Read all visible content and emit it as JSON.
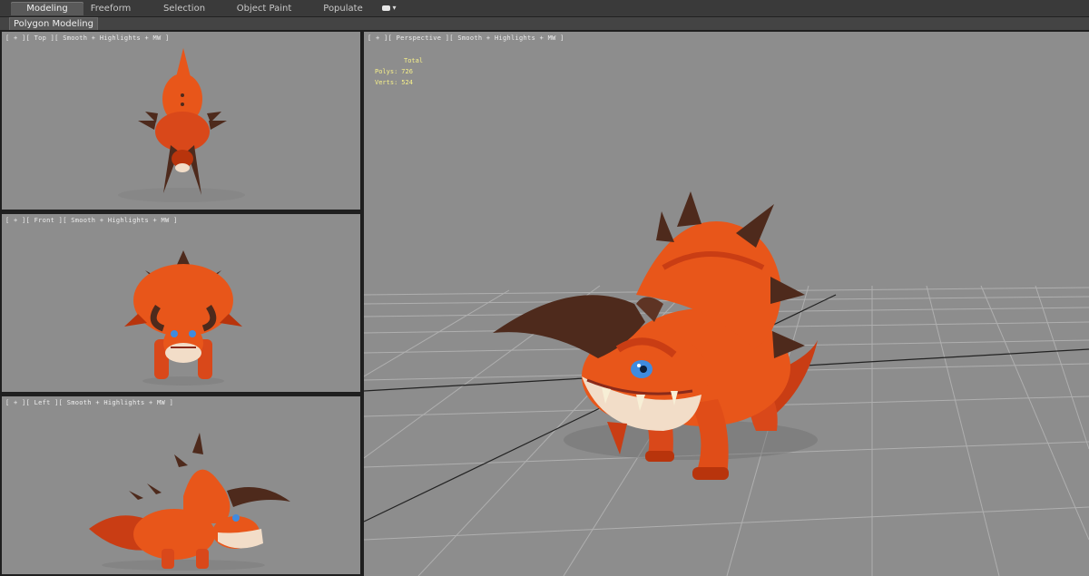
{
  "ribbon": {
    "tabs": [
      {
        "label": "Modeling",
        "active": true
      },
      {
        "label": "Freeform",
        "active": false
      },
      {
        "label": "Selection",
        "active": false
      },
      {
        "label": "Object Paint",
        "active": false
      },
      {
        "label": "Populate",
        "active": false
      }
    ],
    "more_icon": "toggle-dropdown-icon",
    "sub_tab": "Polygon Modeling"
  },
  "viewports": {
    "top": {
      "label": "[ + ][ Top ][ Smooth + Highlights + MW ]"
    },
    "front": {
      "label": "[ + ][ Front ][ Smooth + Highlights + MW ]"
    },
    "left": {
      "label": "[ + ][ Left ][ Smooth + Highlights + MW ]"
    },
    "perspective": {
      "label": "[ + ][ Perspective ][ Smooth + Highlights + MW ]",
      "stats": {
        "total_label": "Total",
        "polys_label": "Polys:",
        "polys_value": "726",
        "verts_label": "Verts:",
        "verts_value": "524"
      }
    }
  },
  "colors": {
    "viewport_bg": "#8d8d8d",
    "stats_text": "#f6f08a",
    "creature_body": "#e8561a",
    "creature_dark": "#b8340c",
    "horn": "#4e2a1c",
    "jaw": "#f2ddc8",
    "eye": "#3f8be0"
  }
}
